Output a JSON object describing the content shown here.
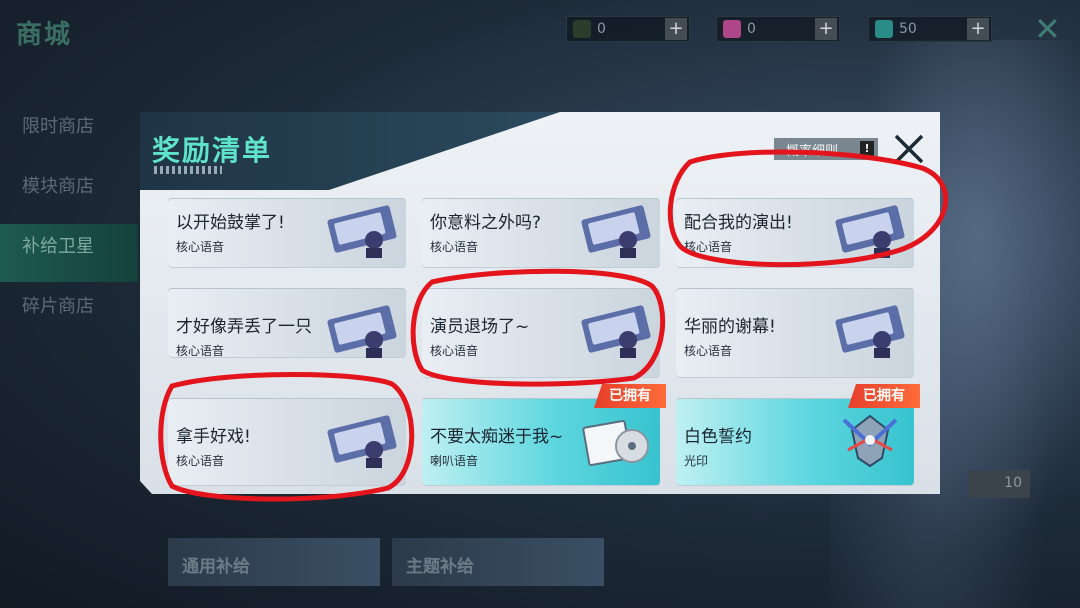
{
  "background": {
    "shop_title": "商城",
    "resources": [
      {
        "icon": "currency-green-icon",
        "value": "0",
        "color": "#2d3d2c"
      },
      {
        "icon": "currency-pink-icon",
        "value": "0",
        "color": "#b0468a"
      },
      {
        "icon": "currency-teal-icon",
        "value": "50",
        "color": "#2a8c86"
      }
    ],
    "sidebar": [
      {
        "label": "限时商店",
        "active": false
      },
      {
        "label": "模块商店",
        "active": false
      },
      {
        "label": "补给卫星",
        "active": true
      },
      {
        "label": "碎片商店",
        "active": false
      }
    ],
    "bottom_tabs": [
      "通用补给",
      "主题补给"
    ],
    "count_value": "10"
  },
  "modal": {
    "title": "奖励清单",
    "rules_label": "概率细则",
    "rules_icon": "!",
    "close_icon": "close-icon"
  },
  "cards": [
    {
      "name": "以开始鼓掌了!",
      "type": "核心语音",
      "owned": false,
      "thumb": "voice-card-icon"
    },
    {
      "name": "你意料之外吗?",
      "type": "核心语音",
      "owned": false,
      "thumb": "voice-card-icon"
    },
    {
      "name": "配合我的演出!",
      "type": "核心语音",
      "owned": false,
      "thumb": "voice-card-icon"
    },
    {
      "name": "才好像弄丢了一只",
      "type": "核心语音",
      "owned": false,
      "thumb": "voice-card-icon"
    },
    {
      "name": "演员退场了~",
      "type": "核心语音",
      "owned": false,
      "thumb": "voice-card-icon"
    },
    {
      "name": "华丽的谢幕!",
      "type": "核心语音",
      "owned": false,
      "thumb": "voice-card-icon"
    },
    {
      "name": "拿手好戏!",
      "type": "核心语音",
      "owned": false,
      "thumb": "voice-card-icon"
    },
    {
      "name": "不要太痴迷于我~",
      "type": "喇叭语音",
      "owned": true,
      "thumb": "cd-player-icon"
    },
    {
      "name": "白色誓约",
      "type": "光印",
      "owned": true,
      "thumb": "emblem-icon"
    }
  ],
  "owned_badge_label": "已拥有",
  "annotation_color": "#e3141c"
}
